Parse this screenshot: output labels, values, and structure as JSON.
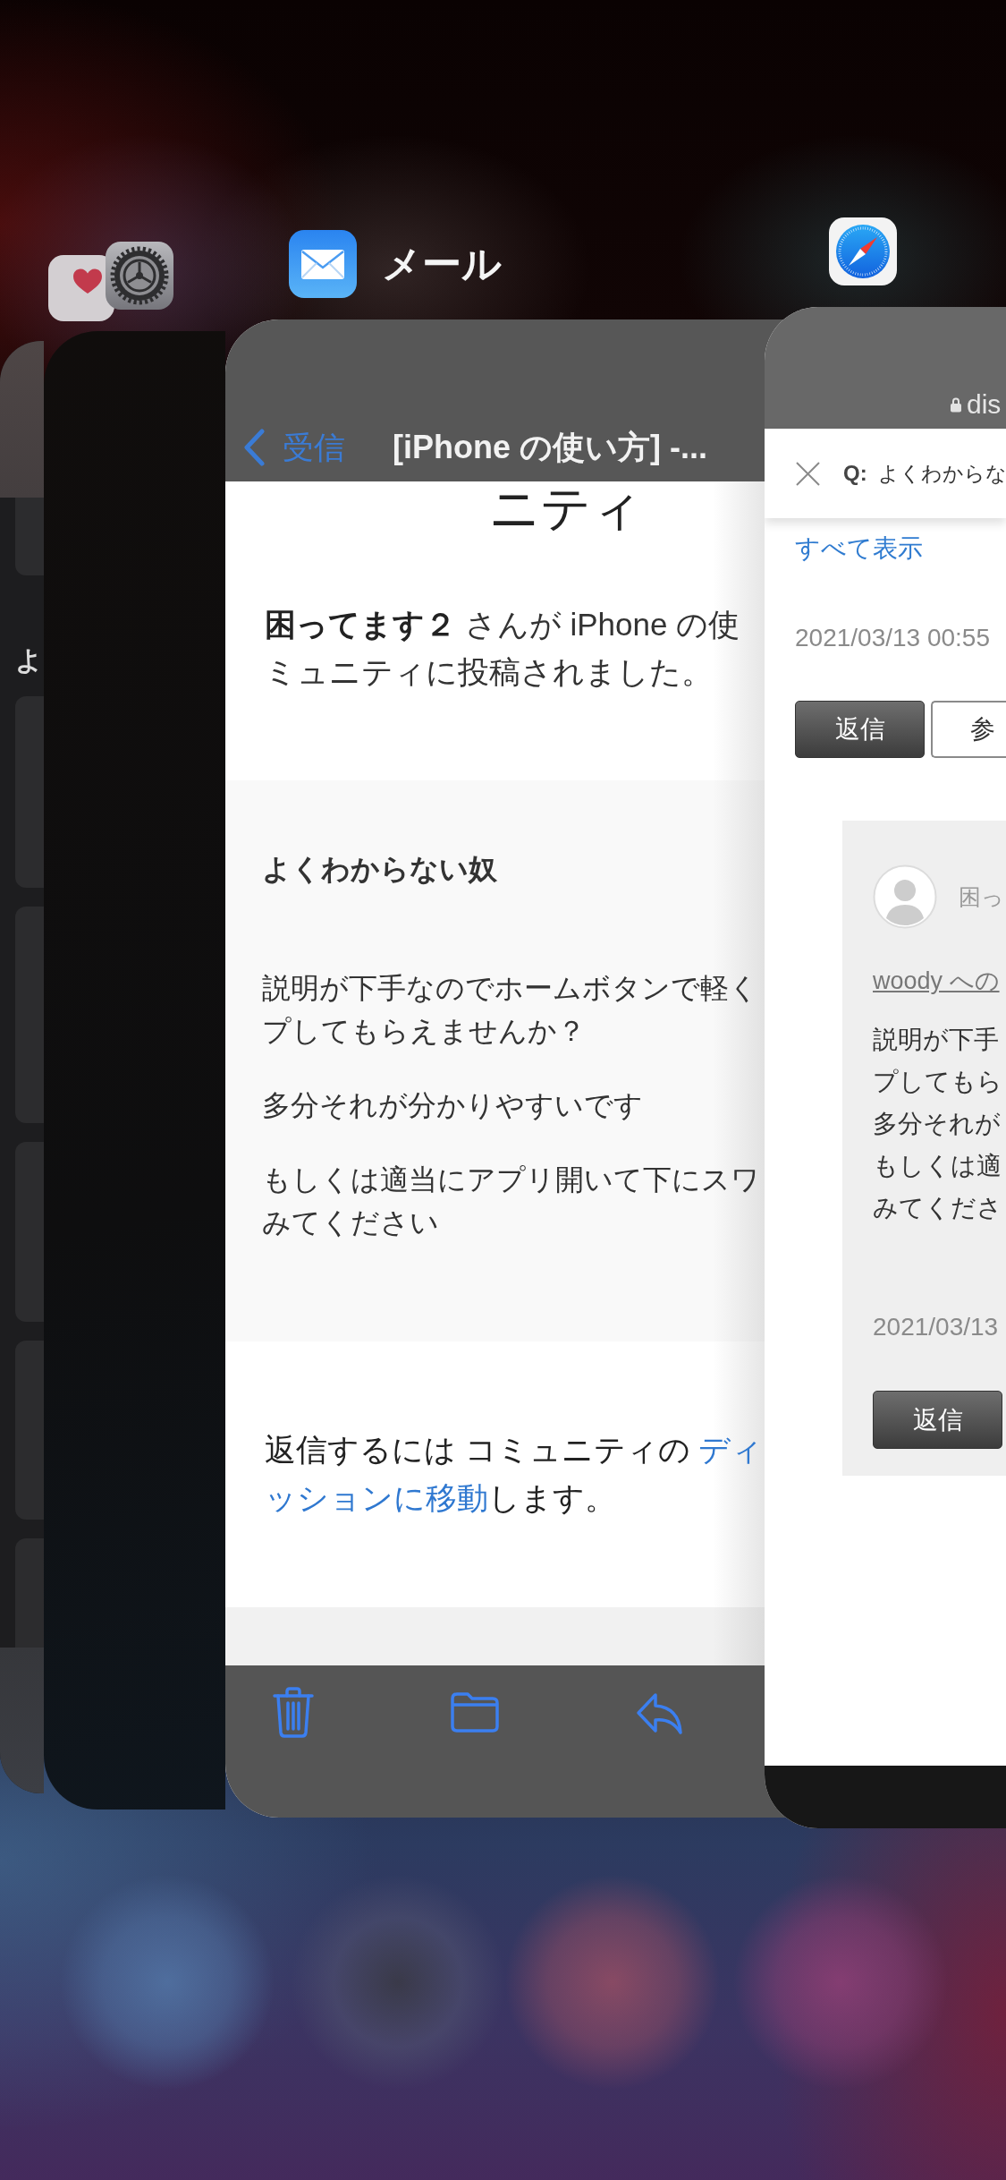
{
  "cards": [
    {
      "kind": "list",
      "section_heading": "よ"
    },
    {
      "kind": "blank"
    },
    {
      "kind": "mail",
      "app_name": "メール",
      "back_label": "受信",
      "title": "[iPhone の使い方] -...",
      "heading": "ニティ",
      "notice": [
        "**困ってます２** さんが iPhone の使",
        "ミュニティに投稿されました。"
      ],
      "post_author": "よくわからない奴",
      "post_paragraphs": [
        [
          "説明が下手なのでホームボタンで軽く",
          "プしてもらえませんか？"
        ],
        [
          "多分それが分かりやすいです"
        ],
        [
          "もしくは適当にアプリ開いて下にスワ",
          "みてください"
        ]
      ],
      "reply_note": {
        "before": "返信するには コミュニティの ",
        "link_lines": [
          "ディ",
          "ッションに移動"
        ],
        "after": "します。"
      }
    },
    {
      "kind": "safari",
      "address": "dis",
      "question_prefix": "Q:",
      "question_title": "よくわからな",
      "show_all": "すべて表示",
      "timestamp": "2021/03/13 00:55",
      "actions": [
        {
          "kind": "filled",
          "label": "返信"
        },
        {
          "kind": "outlined",
          "label": "参"
        }
      ],
      "reply": {
        "author": "困っ",
        "in_reply_to": "woody への",
        "paragraphs": [
          [
            "説明が下手",
            "プしてもら"
          ],
          [
            "多分それが"
          ],
          [
            "もしくは適",
            "みてくださ"
          ]
        ],
        "timestamp": "2021/03/13",
        "action": "返信"
      }
    }
  ]
}
